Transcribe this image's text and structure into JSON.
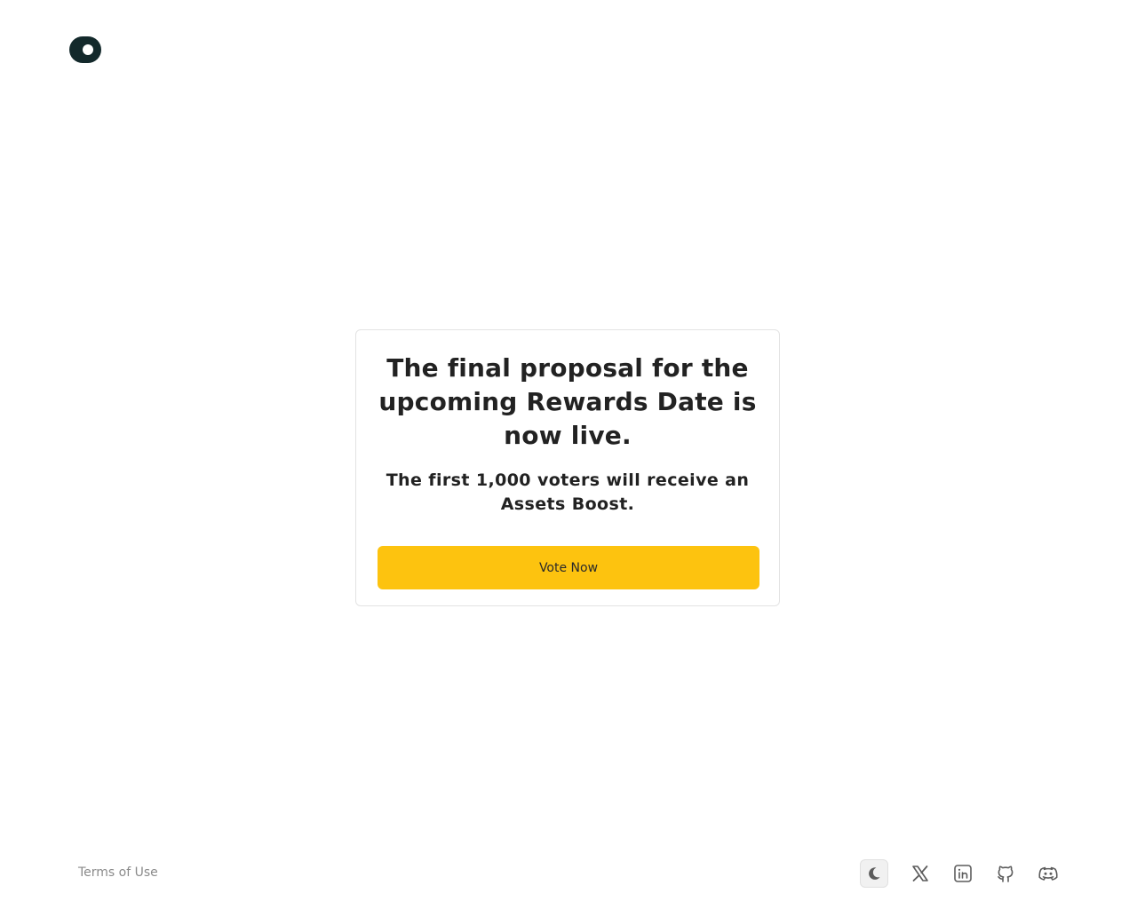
{
  "header": {
    "logo_icon": "toggle-logo-icon"
  },
  "announcement": {
    "title": "The final proposal for the upcoming Rewards Date is now live.",
    "subtitle": "The first 1,000 voters will receive an Assets Boost.",
    "button_label": "Vote Now"
  },
  "footer": {
    "terms_label": "Terms of Use",
    "icons": [
      "moon-icon",
      "x-icon",
      "linkedin-icon",
      "github-icon",
      "discord-icon"
    ]
  },
  "colors": {
    "accent": "#fdc30f",
    "logo": "#13292b",
    "text": "#222222",
    "muted": "#8a8a8a",
    "icon": "#5c5c5c"
  }
}
